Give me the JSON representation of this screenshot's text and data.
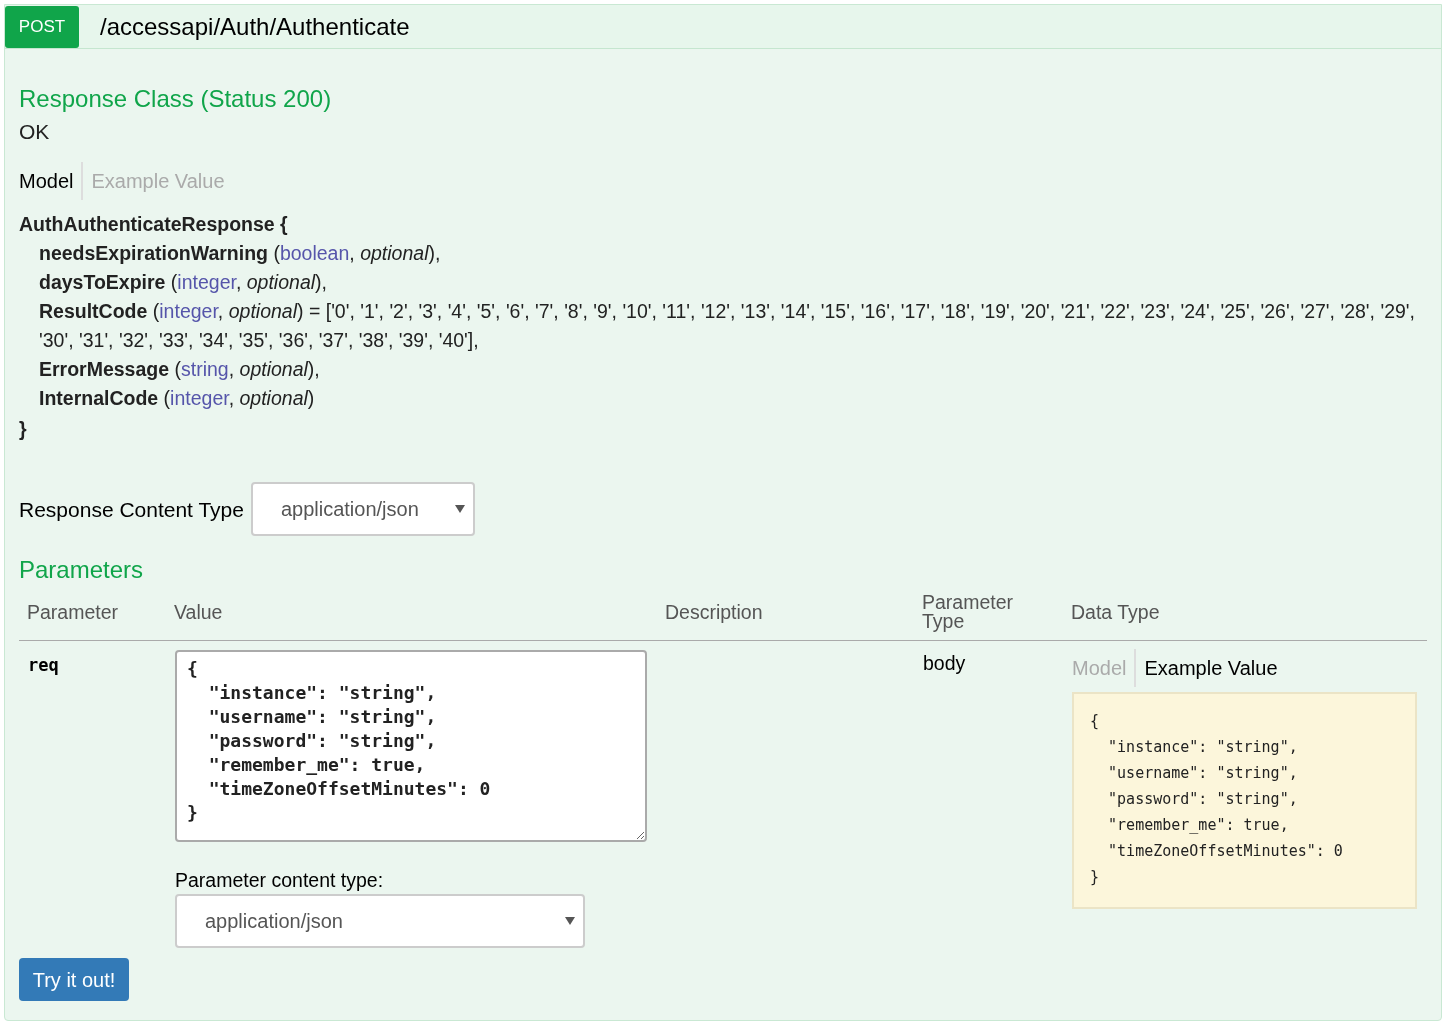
{
  "operation": {
    "method": "POST",
    "path": "/accessapi/Auth/Authenticate"
  },
  "response_class": {
    "heading": "Response Class (Status 200)",
    "description": "OK",
    "tabs": [
      {
        "label": "Model",
        "selected": true
      },
      {
        "label": "Example Value",
        "selected": false
      }
    ],
    "model": {
      "title": "AuthAuthenticateResponse {",
      "properties": [
        {
          "segments": [
            {
              "kind": "name",
              "text": "needsExpirationWarning"
            },
            {
              "kind": "plain",
              "text": " ("
            },
            {
              "kind": "type",
              "text": "boolean"
            },
            {
              "kind": "plain",
              "text": ", "
            },
            {
              "kind": "flag",
              "text": "optional"
            },
            {
              "kind": "plain",
              "text": "),"
            }
          ]
        },
        {
          "segments": [
            {
              "kind": "name",
              "text": "daysToExpire"
            },
            {
              "kind": "plain",
              "text": " ("
            },
            {
              "kind": "type",
              "text": "integer"
            },
            {
              "kind": "plain",
              "text": ", "
            },
            {
              "kind": "flag",
              "text": "optional"
            },
            {
              "kind": "plain",
              "text": "),"
            }
          ]
        },
        {
          "segments": [
            {
              "kind": "name",
              "text": "ResultCode"
            },
            {
              "kind": "plain",
              "text": " ("
            },
            {
              "kind": "type",
              "text": "integer"
            },
            {
              "kind": "plain",
              "text": ", "
            },
            {
              "kind": "flag",
              "text": "optional"
            },
            {
              "kind": "plain",
              "text": ") = ['0', '1', '2', '3', '4', '5', '6', '7', '8', '9', '10', '11', '12', '13', '14', '15', '16', '17', '18', '19', '20', '21', '22', '23', '24', '25', '26', '27', '28', '29', '30', '31', '32', '33', '34', '35', '36', '37', '38', '39', '40'],"
            }
          ]
        },
        {
          "segments": [
            {
              "kind": "name",
              "text": "ErrorMessage"
            },
            {
              "kind": "plain",
              "text": " ("
            },
            {
              "kind": "type",
              "text": "string"
            },
            {
              "kind": "plain",
              "text": ", "
            },
            {
              "kind": "flag",
              "text": "optional"
            },
            {
              "kind": "plain",
              "text": "),"
            }
          ]
        },
        {
          "segments": [
            {
              "kind": "name",
              "text": "InternalCode"
            },
            {
              "kind": "plain",
              "text": " ("
            },
            {
              "kind": "type",
              "text": "integer"
            },
            {
              "kind": "plain",
              "text": ", "
            },
            {
              "kind": "flag",
              "text": "optional"
            },
            {
              "kind": "plain",
              "text": ")"
            }
          ]
        }
      ],
      "closing": "}"
    }
  },
  "response_content_type": {
    "label": "Response Content Type",
    "value": "application/json"
  },
  "parameters": {
    "heading": "Parameters",
    "columns": [
      "Parameter",
      "Value",
      "Description",
      "Parameter Type",
      "Data Type"
    ],
    "rows": [
      {
        "parameter": "req",
        "value": "{\n  \"instance\": \"string\",\n  \"username\": \"string\",\n  \"password\": \"string\",\n  \"remember_me\": true,\n  \"timeZoneOffsetMinutes\": 0\n}",
        "content_type_label": "Parameter content type:",
        "content_type": "application/json",
        "parameter_type": "body",
        "data_type_tabs": [
          {
            "label": "Model",
            "selected": false
          },
          {
            "label": "Example Value",
            "selected": true
          }
        ],
        "example_value": "{\n  \"instance\": \"string\",\n  \"username\": \"string\",\n  \"password\": \"string\",\n  \"remember_me\": true,\n  \"timeZoneOffsetMinutes\": 0\n}"
      }
    ]
  },
  "try_button": "Try it out!"
}
